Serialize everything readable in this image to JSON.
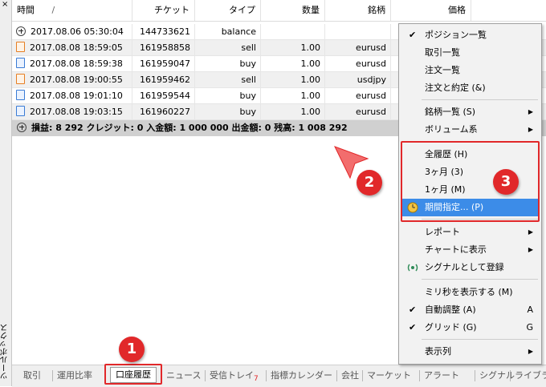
{
  "toolbox": {
    "close": "×",
    "label": "ツールボックス"
  },
  "columns": [
    "時間",
    "/",
    "チケット",
    "タイプ",
    "数量",
    "銘柄",
    "価格"
  ],
  "rows": [
    {
      "icon": "balance-icon",
      "kind": "bal",
      "time": "2017.08.06 05:30:04",
      "ticket": "144733621",
      "type": "balance",
      "qty": "",
      "symbol": ""
    },
    {
      "icon": "sell-order-icon",
      "kind": "sell",
      "time": "2017.08.08 18:59:05",
      "ticket": "161958858",
      "type": "sell",
      "qty": "1.00",
      "symbol": "eurusd"
    },
    {
      "icon": "buy-order-icon",
      "kind": "buy",
      "time": "2017.08.08 18:59:38",
      "ticket": "161959047",
      "type": "buy",
      "qty": "1.00",
      "symbol": "eurusd"
    },
    {
      "icon": "sell-order-icon",
      "kind": "sell",
      "time": "2017.08.08 19:00:55",
      "ticket": "161959462",
      "type": "sell",
      "qty": "1.00",
      "symbol": "usdjpy"
    },
    {
      "icon": "buy-order-icon",
      "kind": "buy",
      "time": "2017.08.08 19:01:10",
      "ticket": "161959544",
      "type": "buy",
      "qty": "1.00",
      "symbol": "eurusd"
    },
    {
      "icon": "buy-order-icon",
      "kind": "buy",
      "time": "2017.08.08 19:03:15",
      "ticket": "161960227",
      "type": "buy",
      "qty": "1.00",
      "symbol": "eurusd"
    }
  ],
  "summary": "損益: 8 292  クレジット: 0  入金額: 1 000 000  出金額: 0  残高: 1 008 292",
  "tabs": [
    "取引",
    "運用比率",
    "口座履歴",
    "ニュース",
    "受信トレイ",
    "指標カレンダー",
    "会社",
    "マーケット",
    "アラート",
    "シグナル",
    "ライブラリ"
  ],
  "inbox_count": "7",
  "menu": [
    {
      "label": "ポジション一覧",
      "check": "✔",
      "arrow": "",
      "shortcut": ""
    },
    {
      "label": "取引一覧",
      "check": "",
      "arrow": "",
      "shortcut": ""
    },
    {
      "label": "注文一覧",
      "check": "",
      "arrow": "",
      "shortcut": ""
    },
    {
      "label": "注文と約定 (&)",
      "check": "",
      "arrow": "",
      "shortcut": ""
    },
    {
      "label": "銘柄一覧 (S)",
      "check": "",
      "arrow": "▶",
      "shortcut": ""
    },
    {
      "label": "ボリューム系",
      "check": "",
      "arrow": "▶",
      "shortcut": ""
    },
    {
      "label": "全履歴 (H)",
      "check": "",
      "arrow": "",
      "shortcut": ""
    },
    {
      "label": "3ヶ月 (3)",
      "check": "",
      "arrow": "",
      "shortcut": ""
    },
    {
      "label": "1ヶ月 (M)",
      "check": "",
      "arrow": "",
      "shortcut": ""
    },
    {
      "label": "期間指定... (P)",
      "check": "",
      "arrow": "",
      "shortcut": ""
    },
    {
      "label": "レポート",
      "check": "",
      "arrow": "▶",
      "shortcut": ""
    },
    {
      "label": "チャートに表示",
      "check": "",
      "arrow": "▶",
      "shortcut": ""
    },
    {
      "label": "シグナルとして登録",
      "check": "",
      "arrow": "",
      "shortcut": ""
    },
    {
      "label": "ミリ秒を表示する (M)",
      "check": "",
      "arrow": "",
      "shortcut": ""
    },
    {
      "label": "自動調整 (A)",
      "check": "✔",
      "arrow": "",
      "shortcut": "A"
    },
    {
      "label": "グリッド (G)",
      "check": "✔",
      "arrow": "",
      "shortcut": "G"
    },
    {
      "label": "表示列",
      "check": "",
      "arrow": "▶",
      "shortcut": ""
    }
  ],
  "callouts": [
    "1",
    "2",
    "3"
  ],
  "colors": {
    "highlight": "#3c8ce8",
    "callout": "#e1282a",
    "summary_bg": "#d0d0d0"
  }
}
